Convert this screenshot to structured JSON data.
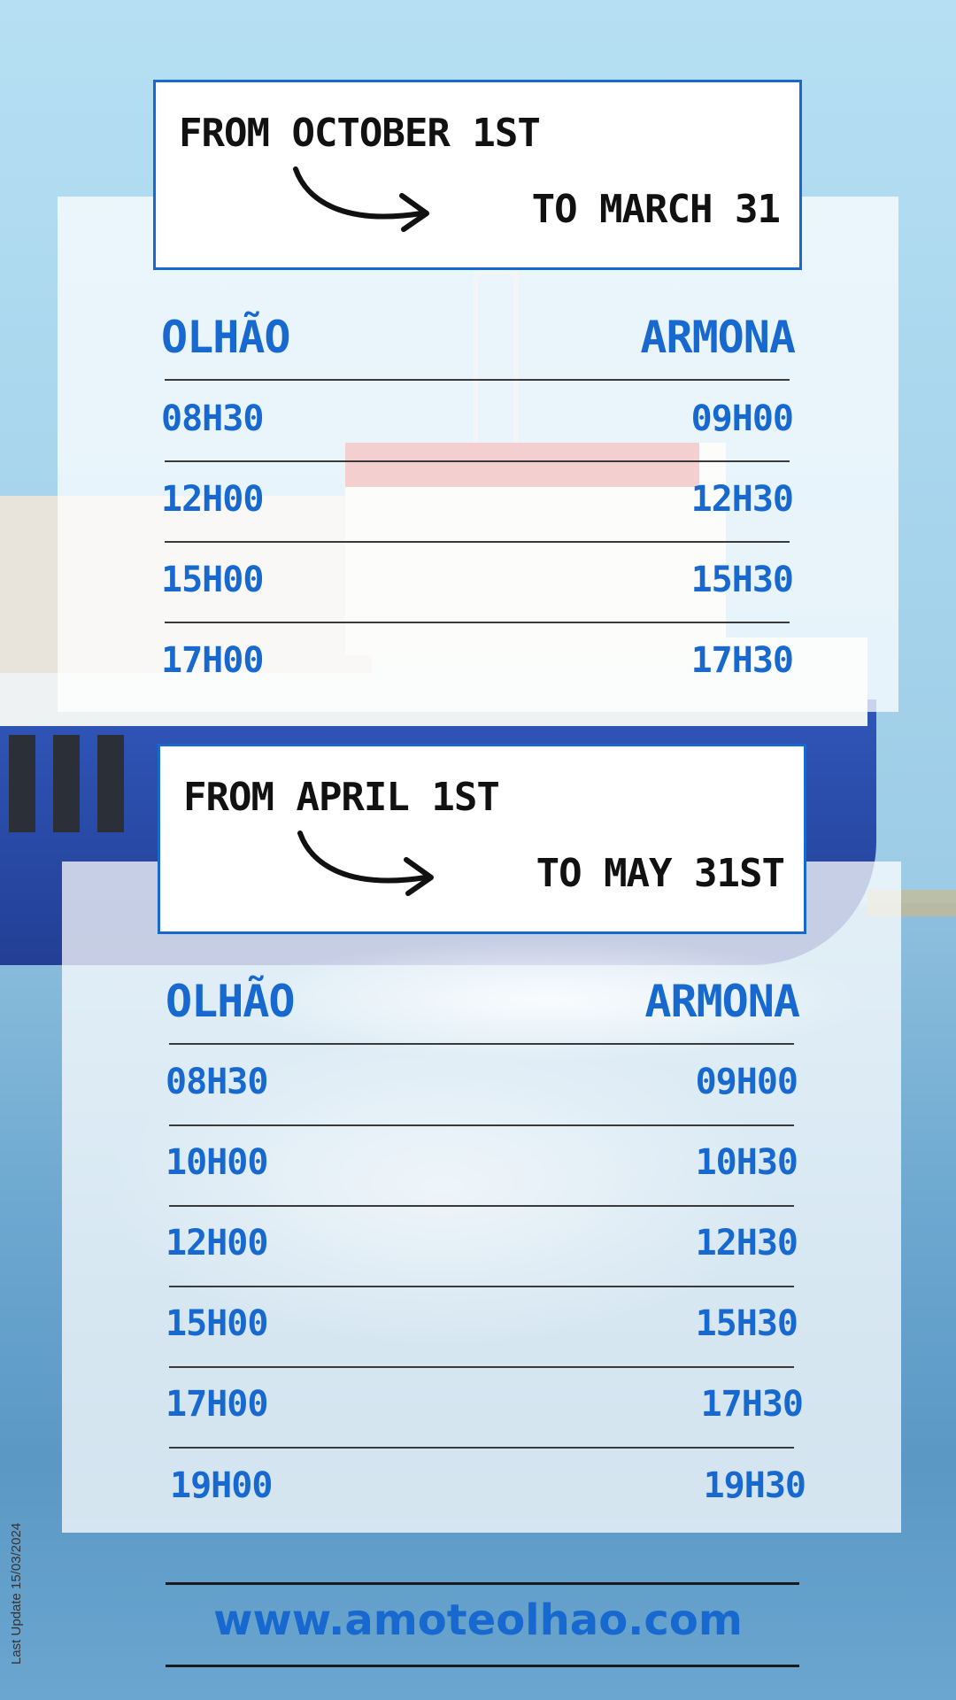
{
  "season_1": {
    "from": "FROM OCTOBER 1ST",
    "to": "TO MARCH 31",
    "headers": {
      "left": "OLHÃO",
      "right": "ARMONA"
    },
    "rows": [
      {
        "olhao": "08H30",
        "armona": "09H00"
      },
      {
        "olhao": "12H00",
        "armona": "12H30"
      },
      {
        "olhao": "15H00",
        "armona": "15H30"
      },
      {
        "olhao": "17H00",
        "armona": "17H30"
      }
    ]
  },
  "season_2": {
    "from": "FROM APRIL 1ST",
    "to": "TO MAY 31ST",
    "headers": {
      "left": "OLHÃO",
      "right": "ARMONA"
    },
    "rows": [
      {
        "olhao": "08H30",
        "armona": "09H00"
      },
      {
        "olhao": "10H00",
        "armona": "10H30"
      },
      {
        "olhao": "12H00",
        "armona": "12H30"
      },
      {
        "olhao": "15H00",
        "armona": "15H30"
      },
      {
        "olhao": "17H00",
        "armona": "17H30"
      },
      {
        "olhao": "19H00",
        "armona": "19H30"
      }
    ]
  },
  "footer": {
    "website": "www.amoteolhao.com",
    "last_update": "Last Update 15/03/2024"
  },
  "colors": {
    "accent": "#1769d0",
    "text": "#111111"
  },
  "icons": {
    "arrow": "curved-arrow-icon"
  }
}
